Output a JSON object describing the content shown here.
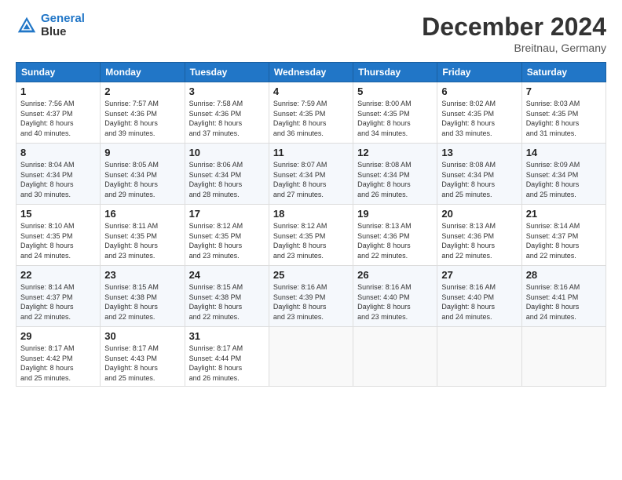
{
  "logo": {
    "line1": "General",
    "line2": "Blue"
  },
  "header": {
    "month": "December 2024",
    "location": "Breitnau, Germany"
  },
  "weekdays": [
    "Sunday",
    "Monday",
    "Tuesday",
    "Wednesday",
    "Thursday",
    "Friday",
    "Saturday"
  ],
  "weeks": [
    [
      {
        "day": "1",
        "sunrise": "Sunrise: 7:56 AM",
        "sunset": "Sunset: 4:37 PM",
        "daylight": "Daylight: 8 hours and 40 minutes."
      },
      {
        "day": "2",
        "sunrise": "Sunrise: 7:57 AM",
        "sunset": "Sunset: 4:36 PM",
        "daylight": "Daylight: 8 hours and 39 minutes."
      },
      {
        "day": "3",
        "sunrise": "Sunrise: 7:58 AM",
        "sunset": "Sunset: 4:36 PM",
        "daylight": "Daylight: 8 hours and 37 minutes."
      },
      {
        "day": "4",
        "sunrise": "Sunrise: 7:59 AM",
        "sunset": "Sunset: 4:35 PM",
        "daylight": "Daylight: 8 hours and 36 minutes."
      },
      {
        "day": "5",
        "sunrise": "Sunrise: 8:00 AM",
        "sunset": "Sunset: 4:35 PM",
        "daylight": "Daylight: 8 hours and 34 minutes."
      },
      {
        "day": "6",
        "sunrise": "Sunrise: 8:02 AM",
        "sunset": "Sunset: 4:35 PM",
        "daylight": "Daylight: 8 hours and 33 minutes."
      },
      {
        "day": "7",
        "sunrise": "Sunrise: 8:03 AM",
        "sunset": "Sunset: 4:35 PM",
        "daylight": "Daylight: 8 hours and 31 minutes."
      }
    ],
    [
      {
        "day": "8",
        "sunrise": "Sunrise: 8:04 AM",
        "sunset": "Sunset: 4:34 PM",
        "daylight": "Daylight: 8 hours and 30 minutes."
      },
      {
        "day": "9",
        "sunrise": "Sunrise: 8:05 AM",
        "sunset": "Sunset: 4:34 PM",
        "daylight": "Daylight: 8 hours and 29 minutes."
      },
      {
        "day": "10",
        "sunrise": "Sunrise: 8:06 AM",
        "sunset": "Sunset: 4:34 PM",
        "daylight": "Daylight: 8 hours and 28 minutes."
      },
      {
        "day": "11",
        "sunrise": "Sunrise: 8:07 AM",
        "sunset": "Sunset: 4:34 PM",
        "daylight": "Daylight: 8 hours and 27 minutes."
      },
      {
        "day": "12",
        "sunrise": "Sunrise: 8:08 AM",
        "sunset": "Sunset: 4:34 PM",
        "daylight": "Daylight: 8 hours and 26 minutes."
      },
      {
        "day": "13",
        "sunrise": "Sunrise: 8:08 AM",
        "sunset": "Sunset: 4:34 PM",
        "daylight": "Daylight: 8 hours and 25 minutes."
      },
      {
        "day": "14",
        "sunrise": "Sunrise: 8:09 AM",
        "sunset": "Sunset: 4:34 PM",
        "daylight": "Daylight: 8 hours and 25 minutes."
      }
    ],
    [
      {
        "day": "15",
        "sunrise": "Sunrise: 8:10 AM",
        "sunset": "Sunset: 4:35 PM",
        "daylight": "Daylight: 8 hours and 24 minutes."
      },
      {
        "day": "16",
        "sunrise": "Sunrise: 8:11 AM",
        "sunset": "Sunset: 4:35 PM",
        "daylight": "Daylight: 8 hours and 23 minutes."
      },
      {
        "day": "17",
        "sunrise": "Sunrise: 8:12 AM",
        "sunset": "Sunset: 4:35 PM",
        "daylight": "Daylight: 8 hours and 23 minutes."
      },
      {
        "day": "18",
        "sunrise": "Sunrise: 8:12 AM",
        "sunset": "Sunset: 4:35 PM",
        "daylight": "Daylight: 8 hours and 23 minutes."
      },
      {
        "day": "19",
        "sunrise": "Sunrise: 8:13 AM",
        "sunset": "Sunset: 4:36 PM",
        "daylight": "Daylight: 8 hours and 22 minutes."
      },
      {
        "day": "20",
        "sunrise": "Sunrise: 8:13 AM",
        "sunset": "Sunset: 4:36 PM",
        "daylight": "Daylight: 8 hours and 22 minutes."
      },
      {
        "day": "21",
        "sunrise": "Sunrise: 8:14 AM",
        "sunset": "Sunset: 4:37 PM",
        "daylight": "Daylight: 8 hours and 22 minutes."
      }
    ],
    [
      {
        "day": "22",
        "sunrise": "Sunrise: 8:14 AM",
        "sunset": "Sunset: 4:37 PM",
        "daylight": "Daylight: 8 hours and 22 minutes."
      },
      {
        "day": "23",
        "sunrise": "Sunrise: 8:15 AM",
        "sunset": "Sunset: 4:38 PM",
        "daylight": "Daylight: 8 hours and 22 minutes."
      },
      {
        "day": "24",
        "sunrise": "Sunrise: 8:15 AM",
        "sunset": "Sunset: 4:38 PM",
        "daylight": "Daylight: 8 hours and 22 minutes."
      },
      {
        "day": "25",
        "sunrise": "Sunrise: 8:16 AM",
        "sunset": "Sunset: 4:39 PM",
        "daylight": "Daylight: 8 hours and 23 minutes."
      },
      {
        "day": "26",
        "sunrise": "Sunrise: 8:16 AM",
        "sunset": "Sunset: 4:40 PM",
        "daylight": "Daylight: 8 hours and 23 minutes."
      },
      {
        "day": "27",
        "sunrise": "Sunrise: 8:16 AM",
        "sunset": "Sunset: 4:40 PM",
        "daylight": "Daylight: 8 hours and 24 minutes."
      },
      {
        "day": "28",
        "sunrise": "Sunrise: 8:16 AM",
        "sunset": "Sunset: 4:41 PM",
        "daylight": "Daylight: 8 hours and 24 minutes."
      }
    ],
    [
      {
        "day": "29",
        "sunrise": "Sunrise: 8:17 AM",
        "sunset": "Sunset: 4:42 PM",
        "daylight": "Daylight: 8 hours and 25 minutes."
      },
      {
        "day": "30",
        "sunrise": "Sunrise: 8:17 AM",
        "sunset": "Sunset: 4:43 PM",
        "daylight": "Daylight: 8 hours and 25 minutes."
      },
      {
        "day": "31",
        "sunrise": "Sunrise: 8:17 AM",
        "sunset": "Sunset: 4:44 PM",
        "daylight": "Daylight: 8 hours and 26 minutes."
      },
      null,
      null,
      null,
      null
    ]
  ]
}
